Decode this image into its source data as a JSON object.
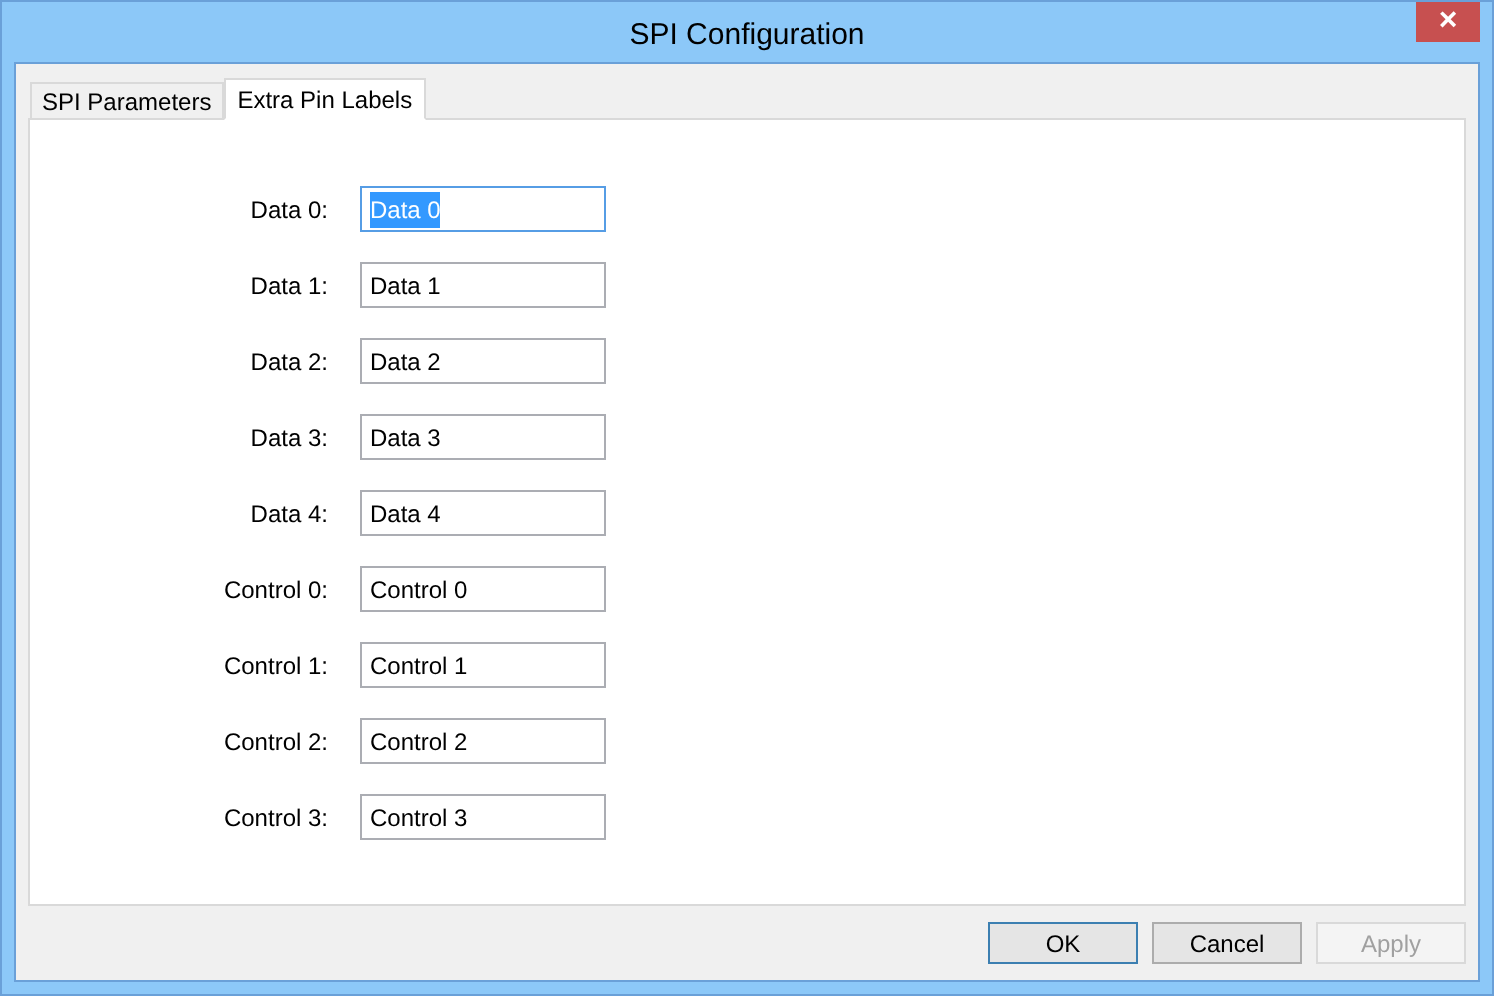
{
  "window": {
    "title": "SPI Configuration",
    "close": "×"
  },
  "tabs": [
    {
      "label": "SPI Parameters",
      "selected": false
    },
    {
      "label": "Extra Pin Labels",
      "selected": true
    }
  ],
  "fields": [
    {
      "label": "Data 0:",
      "value": "Data 0",
      "focused": true
    },
    {
      "label": "Data 1:",
      "value": "Data 1",
      "focused": false
    },
    {
      "label": "Data 2:",
      "value": "Data 2",
      "focused": false
    },
    {
      "label": "Data 3:",
      "value": "Data 3",
      "focused": false
    },
    {
      "label": "Data 4:",
      "value": "Data 4",
      "focused": false
    },
    {
      "label": "Control 0:",
      "value": "Control 0",
      "focused": false
    },
    {
      "label": "Control 1:",
      "value": "Control 1",
      "focused": false
    },
    {
      "label": "Control 2:",
      "value": "Control 2",
      "focused": false
    },
    {
      "label": "Control 3:",
      "value": "Control 3",
      "focused": false
    }
  ],
  "buttons": [
    {
      "label": "OK",
      "default": true,
      "disabled": false
    },
    {
      "label": "Cancel",
      "default": false,
      "disabled": false
    },
    {
      "label": "Apply",
      "default": false,
      "disabled": true
    }
  ]
}
